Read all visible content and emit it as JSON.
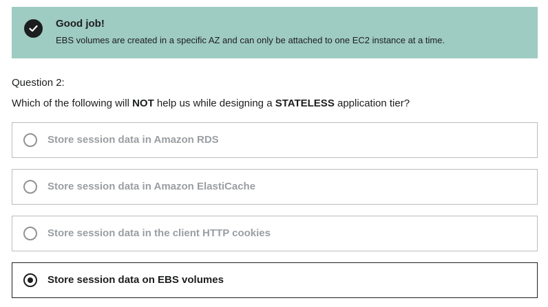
{
  "feedback": {
    "icon": "check-circle-icon",
    "title": "Good job!",
    "message": "EBS volumes are created in a specific AZ and can only be attached to one EC2 instance at a time.",
    "background_color": "#9ecbc2"
  },
  "question": {
    "label": "Question 2:",
    "text_part1": "Which of the following will ",
    "text_bold1": "NOT",
    "text_part2": " help us while designing a ",
    "text_bold2": "STATELESS",
    "text_part3": " application tier?",
    "options": [
      {
        "label": "Store session data in Amazon RDS",
        "selected": false
      },
      {
        "label": "Store session data in Amazon ElastiCache",
        "selected": false
      },
      {
        "label": "Store session data in the client HTTP cookies",
        "selected": false
      },
      {
        "label": "Store session data on EBS volumes",
        "selected": true
      }
    ]
  }
}
